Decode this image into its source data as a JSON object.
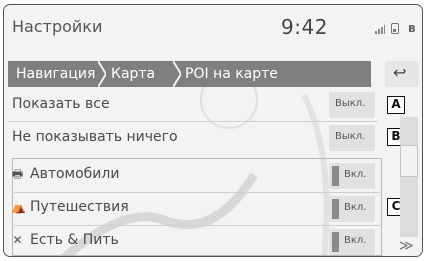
{
  "status": {
    "title": "Настройки",
    "clock": "9:42",
    "signal_icon": "signal-icon",
    "phone_icon": "phone-icon",
    "bt_icon": "bluetooth-icon",
    "bt_glyph": "ʙ"
  },
  "breadcrumb": {
    "items": [
      "Навигация",
      "Карта",
      "POI на карте"
    ],
    "back_icon": "back-arrow-icon",
    "back_glyph": "↩"
  },
  "list": {
    "show_all": {
      "label": "Показать все",
      "toggle": "Выкл."
    },
    "show_none": {
      "label": "Не показывать ничего",
      "toggle": "Выкл."
    },
    "categories": [
      {
        "label": "Автомобили",
        "icon": "car-icon",
        "glyph": "🖶",
        "toggle": "Вкл."
      },
      {
        "label": "Путешествия",
        "icon": "travel-icon",
        "glyph": "⛺",
        "toggle": "Вкл."
      },
      {
        "label": "Есть & Пить",
        "icon": "food-icon",
        "glyph": "✕",
        "toggle": "Вкл."
      }
    ]
  },
  "callouts": [
    "A",
    "B",
    "C"
  ],
  "scroll": {
    "up_icon": "scroll-up-icon",
    "down_icon": "scroll-down-icon",
    "down_glyph": "≫"
  }
}
